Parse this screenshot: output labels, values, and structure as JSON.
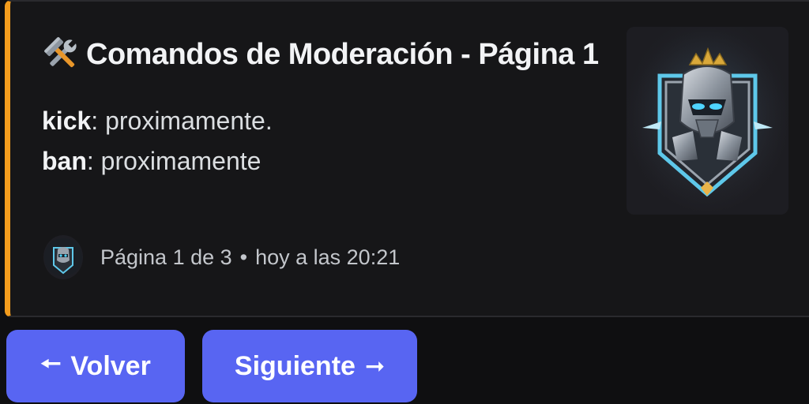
{
  "embed": {
    "accent_color": "#f39c1d",
    "title_icon": "hammer-and-wrench-icon",
    "title": "Comandos de Moderación - Página 1",
    "fields": [
      {
        "name": "kick",
        "value": ": proximamente."
      },
      {
        "name": "ban",
        "value": ": proximamente"
      }
    ],
    "thumbnail": "robot-knight-emblem",
    "footer": {
      "avatar": "robot-knight-emblem",
      "page_text": "Página 1 de 3",
      "separator": "•",
      "timestamp": "hoy a las 20:21"
    }
  },
  "buttons": {
    "back": {
      "arrow": "🠔",
      "label": "Volver"
    },
    "next": {
      "label": "Siguiente",
      "arrow": "➞"
    },
    "color": "#5865f2"
  }
}
